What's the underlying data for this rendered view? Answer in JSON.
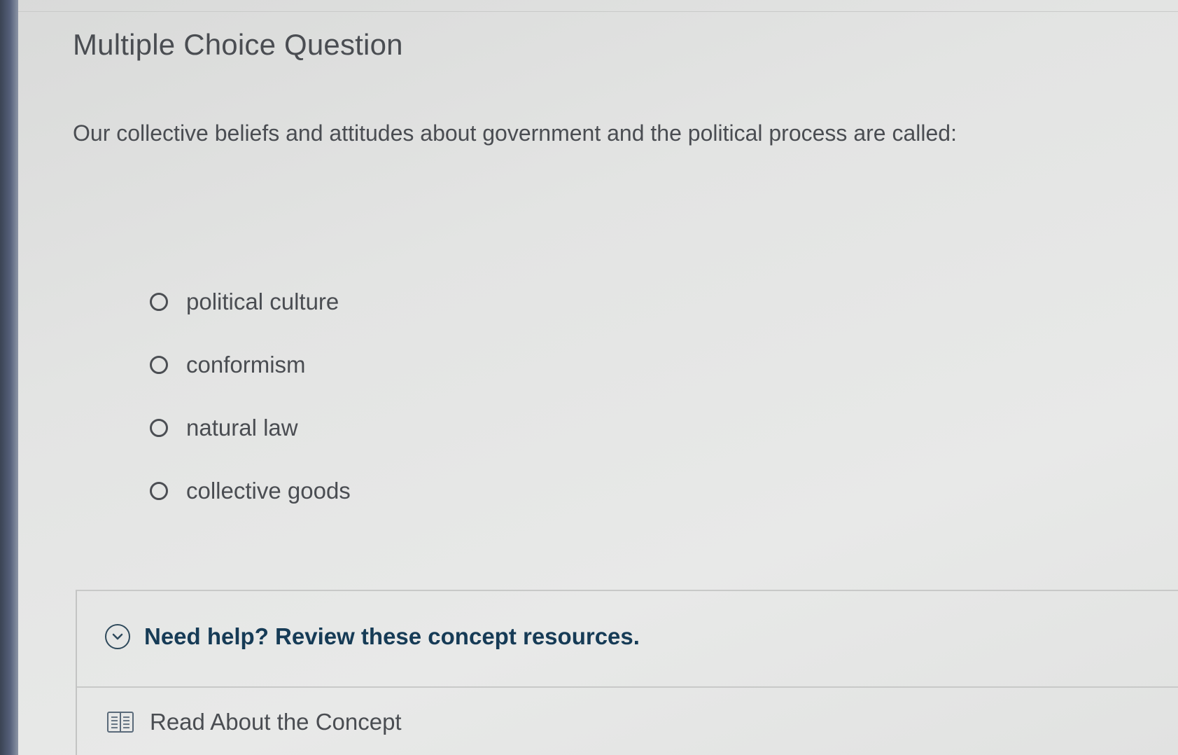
{
  "question": {
    "type_label": "Multiple Choice Question",
    "prompt": "Our collective beliefs and attitudes about government and the political process are called:",
    "choices": [
      {
        "label": "political culture",
        "selected": false
      },
      {
        "label": "conformism",
        "selected": false
      },
      {
        "label": "natural law",
        "selected": false
      },
      {
        "label": "collective goods",
        "selected": false
      }
    ]
  },
  "help": {
    "title": "Need help? Review these concept resources.",
    "expand_icon": "chevron-down-circle-icon",
    "resources": [
      {
        "label": "Read About the Concept",
        "icon": "book-icon"
      }
    ]
  },
  "colors": {
    "background": "#e4e5e4",
    "text": "#4a4d52",
    "help_title": "#163b56"
  }
}
